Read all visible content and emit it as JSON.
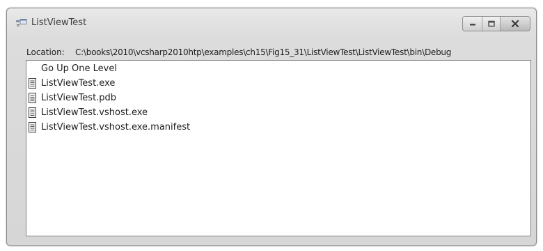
{
  "window": {
    "title": "ListViewTest",
    "title_icon": "app-window-icon",
    "caption_buttons": [
      "minimize-icon",
      "maximize-icon",
      "close-icon"
    ]
  },
  "location": {
    "label": "Location:",
    "path": "C:\\books\\2010\\vcsharp2010htp\\examples\\ch15\\Fig15_31\\ListViewTest\\ListViewTest\\bin\\Debug"
  },
  "list": {
    "items": [
      {
        "label": "Go Up One Level",
        "icon": ""
      },
      {
        "label": "ListViewTest.exe",
        "icon": "file-icon"
      },
      {
        "label": "ListViewTest.pdb",
        "icon": "file-icon"
      },
      {
        "label": "ListViewTest.vshost.exe",
        "icon": "file-icon"
      },
      {
        "label": "ListViewTest.vshost.exe.manifest",
        "icon": "file-icon"
      }
    ]
  }
}
